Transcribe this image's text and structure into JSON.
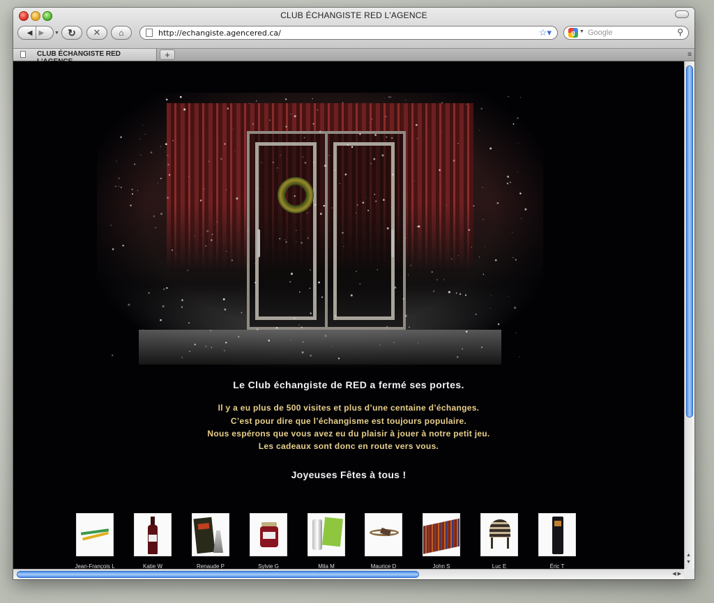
{
  "window": {
    "title": "CLUB ÉCHANGISTE RED L'AGENCE"
  },
  "toolbar": {
    "back_icon": "◀",
    "forward_icon": "▶",
    "reload_icon": "↻",
    "stop_icon": "✕",
    "home_icon": "⌂",
    "url": "http://echangiste.agencered.ca/",
    "bookmark_icon": "☆▾",
    "search_placeholder": "Google",
    "search_icon": "⚲"
  },
  "tabs": [
    {
      "label": "CLUB ÉCHANGISTE RED L'AGENCE"
    }
  ],
  "new_tab_label": "+",
  "tab_menu_icon": "≡",
  "message": {
    "headline": "Le Club échangiste de RED a fermé ses portes.",
    "lines": [
      "Il y a eu plus de 500 visites et plus d’une centaine d’échanges.",
      "C’est pour dire que l’échangisme est toujours populaire.",
      "Nous espérons que vous avez eu du plaisir à jouer à notre petit jeu.",
      "Les cadeaux sont donc en route vers vous."
    ],
    "greeting": "Joyeuses Fêtes à tous !"
  },
  "gifts": [
    {
      "name": "Jean-François L",
      "icon": "pencils-icon"
    },
    {
      "name": "Katie W",
      "icon": "wine-bottle-icon"
    },
    {
      "name": "Renaude P",
      "icon": "book-vase-icon"
    },
    {
      "name": "Sylvie G",
      "icon": "jam-jar-icon"
    },
    {
      "name": "Mila M",
      "icon": "shaker-icon"
    },
    {
      "name": "Maurice D",
      "icon": "bracelet-icon"
    },
    {
      "name": "John S",
      "icon": "striped-scarf-icon"
    },
    {
      "name": "Luc E",
      "icon": "knit-hat-icon"
    },
    {
      "name": "Éric T",
      "icon": "bottle-tube-icon"
    }
  ]
}
